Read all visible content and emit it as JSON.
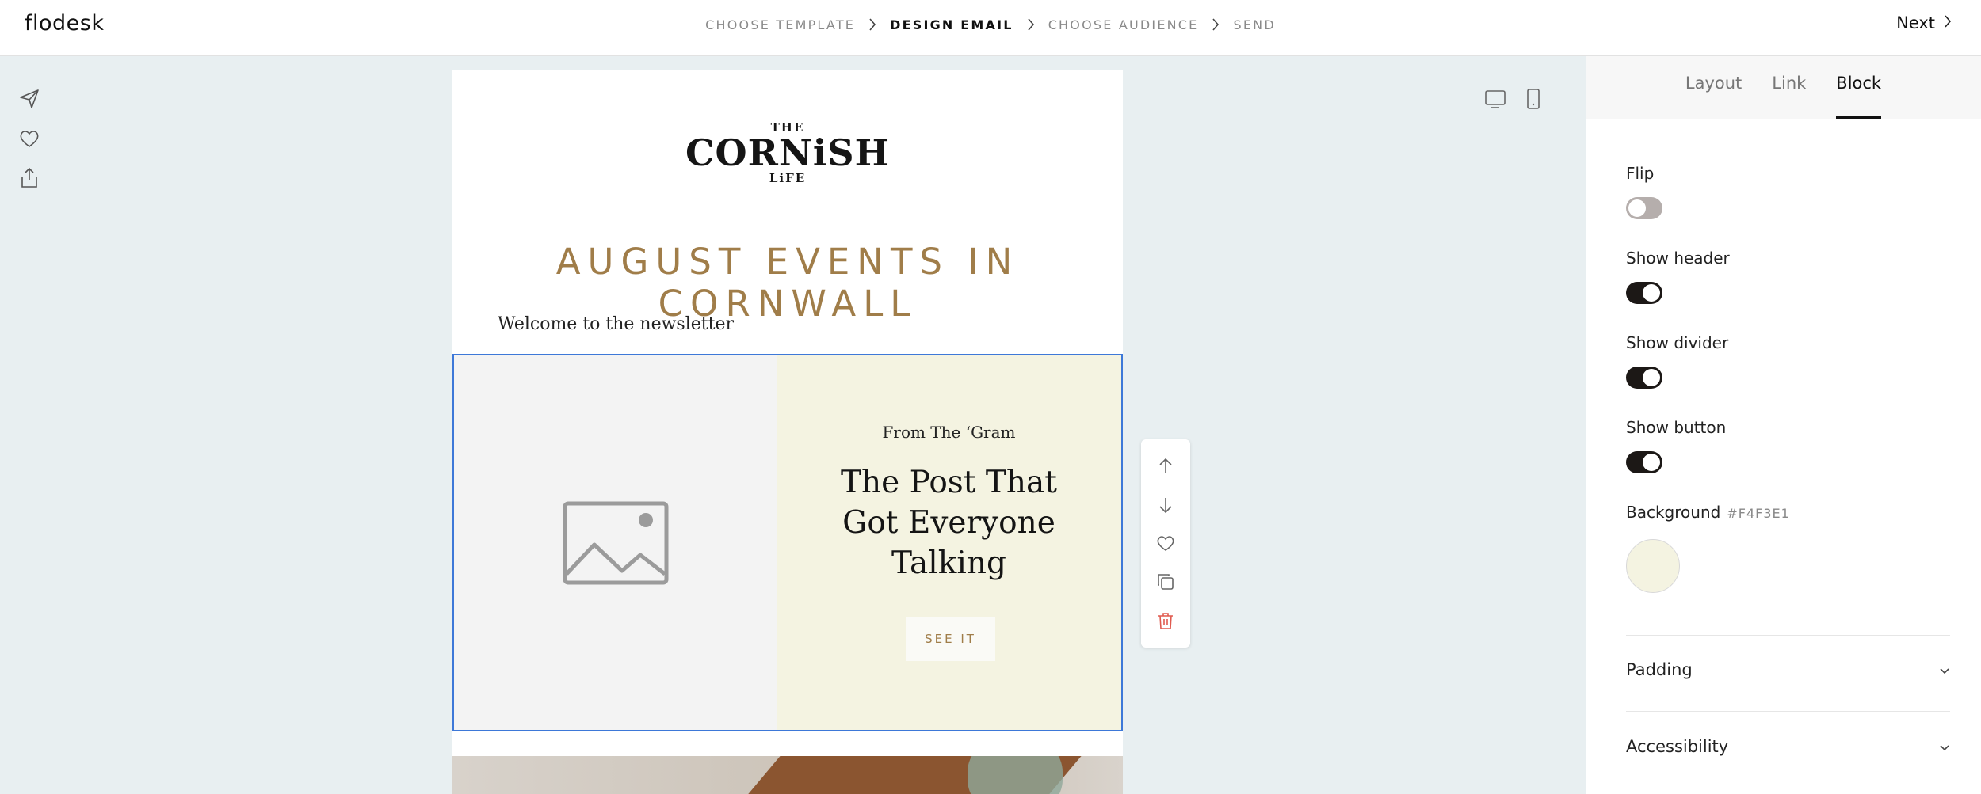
{
  "app": {
    "logo": "flodesk"
  },
  "steps": [
    {
      "label": "CHOOSE TEMPLATE",
      "active": false
    },
    {
      "label": "DESIGN EMAIL",
      "active": true
    },
    {
      "label": "CHOOSE AUDIENCE",
      "active": false
    },
    {
      "label": "SEND",
      "active": false
    }
  ],
  "header": {
    "next_label": "Next"
  },
  "left_tools": [
    "send-icon",
    "heart-icon",
    "share-icon"
  ],
  "devices": [
    "desktop-icon",
    "mobile-icon"
  ],
  "email": {
    "brand_top": "THE",
    "brand_main": "CORNiSH",
    "brand_bottom": "LiFE",
    "headline": "AUGUST EVENTS IN CORNWALL",
    "welcome": "Welcome to the newsletter",
    "block": {
      "pre_title": "From The ‘Gram",
      "title": "The Post That Got Everyone Talking",
      "button": "SEE IT"
    }
  },
  "block_actions": [
    "arrow-up-icon",
    "arrow-down-icon",
    "heart-icon",
    "duplicate-icon",
    "trash-icon"
  ],
  "panel": {
    "tabs": [
      {
        "label": "Layout",
        "active": false
      },
      {
        "label": "Link",
        "active": false
      },
      {
        "label": "Block",
        "active": true
      }
    ],
    "flip": {
      "label": "Flip",
      "on": false
    },
    "show_header": {
      "label": "Show header",
      "on": true
    },
    "show_divider": {
      "label": "Show divider",
      "on": true
    },
    "show_button": {
      "label": "Show button",
      "on": true
    },
    "background": {
      "label": "Background",
      "hex": "#F4F3E1"
    },
    "padding": {
      "label": "Padding"
    },
    "accessibility": {
      "label": "Accessibility"
    }
  },
  "colors": {
    "selection": "#3d78d8",
    "accent": "#a07d49",
    "block_bg": "#f4f3e1",
    "toggle_on": "#1c1816",
    "delete": "#e05a4f"
  }
}
